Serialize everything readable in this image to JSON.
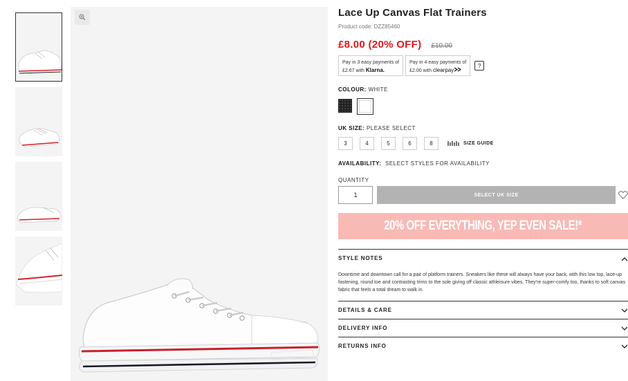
{
  "gallery": {
    "zoom_icon": "magnifier-icon",
    "thumbnail_count": 4
  },
  "product": {
    "title": "Lace Up Canvas Flat Trainers",
    "code": "Product code: DZZ85460",
    "price": "£8.00 (20% OFF)",
    "was_price": "£10.00"
  },
  "payments": {
    "klarna_line1": "Pay in 3 easy payments of",
    "klarna_line2": "£2.67 with",
    "klarna_brand": "Klarna.",
    "clearpay_line1": "Pay in 4 easy payments of",
    "clearpay_line2": "£2.00 with",
    "clearpay_brand": "clearpay",
    "help": "?"
  },
  "colour": {
    "label": "COLOUR:",
    "value": "WHITE",
    "options": [
      "black",
      "white"
    ],
    "selected": "white"
  },
  "size": {
    "label": "UK SIZE:",
    "value": "PLEASE SELECT",
    "options": [
      "3",
      "4",
      "5",
      "6",
      "8"
    ],
    "guide_label": "SIZE GUIDE"
  },
  "availability": {
    "label": "AVAILABILITY:",
    "value": "SELECT STYLES FOR AVAILABILITY"
  },
  "quantity": {
    "label": "QUANTITY",
    "value": "1",
    "button": "SELECT UK SIZE"
  },
  "promo": {
    "text": "20% OFF EVERYTHING, YEP EVEN SALE!*"
  },
  "accordion": {
    "style_notes": "STYLE NOTES",
    "style_notes_body": "Downtime and downtown call for a pair of platform trainers. Sneakers like these will always have your back, with this low top, lace-up fastening, round toe and contrasting trims to the sole giving off classic athleisure vibes. They're super-comfy too, thanks to soft canvas fabric that feels a total dream to walk in.",
    "details": "DETAILS & CARE",
    "delivery": "DELIVERY INFO",
    "returns": "RETURNS INFO"
  },
  "colors": {
    "sale_red": "#e0171a",
    "promo_pink": "#f9b9b5",
    "button_grey": "#b3b3b3"
  }
}
